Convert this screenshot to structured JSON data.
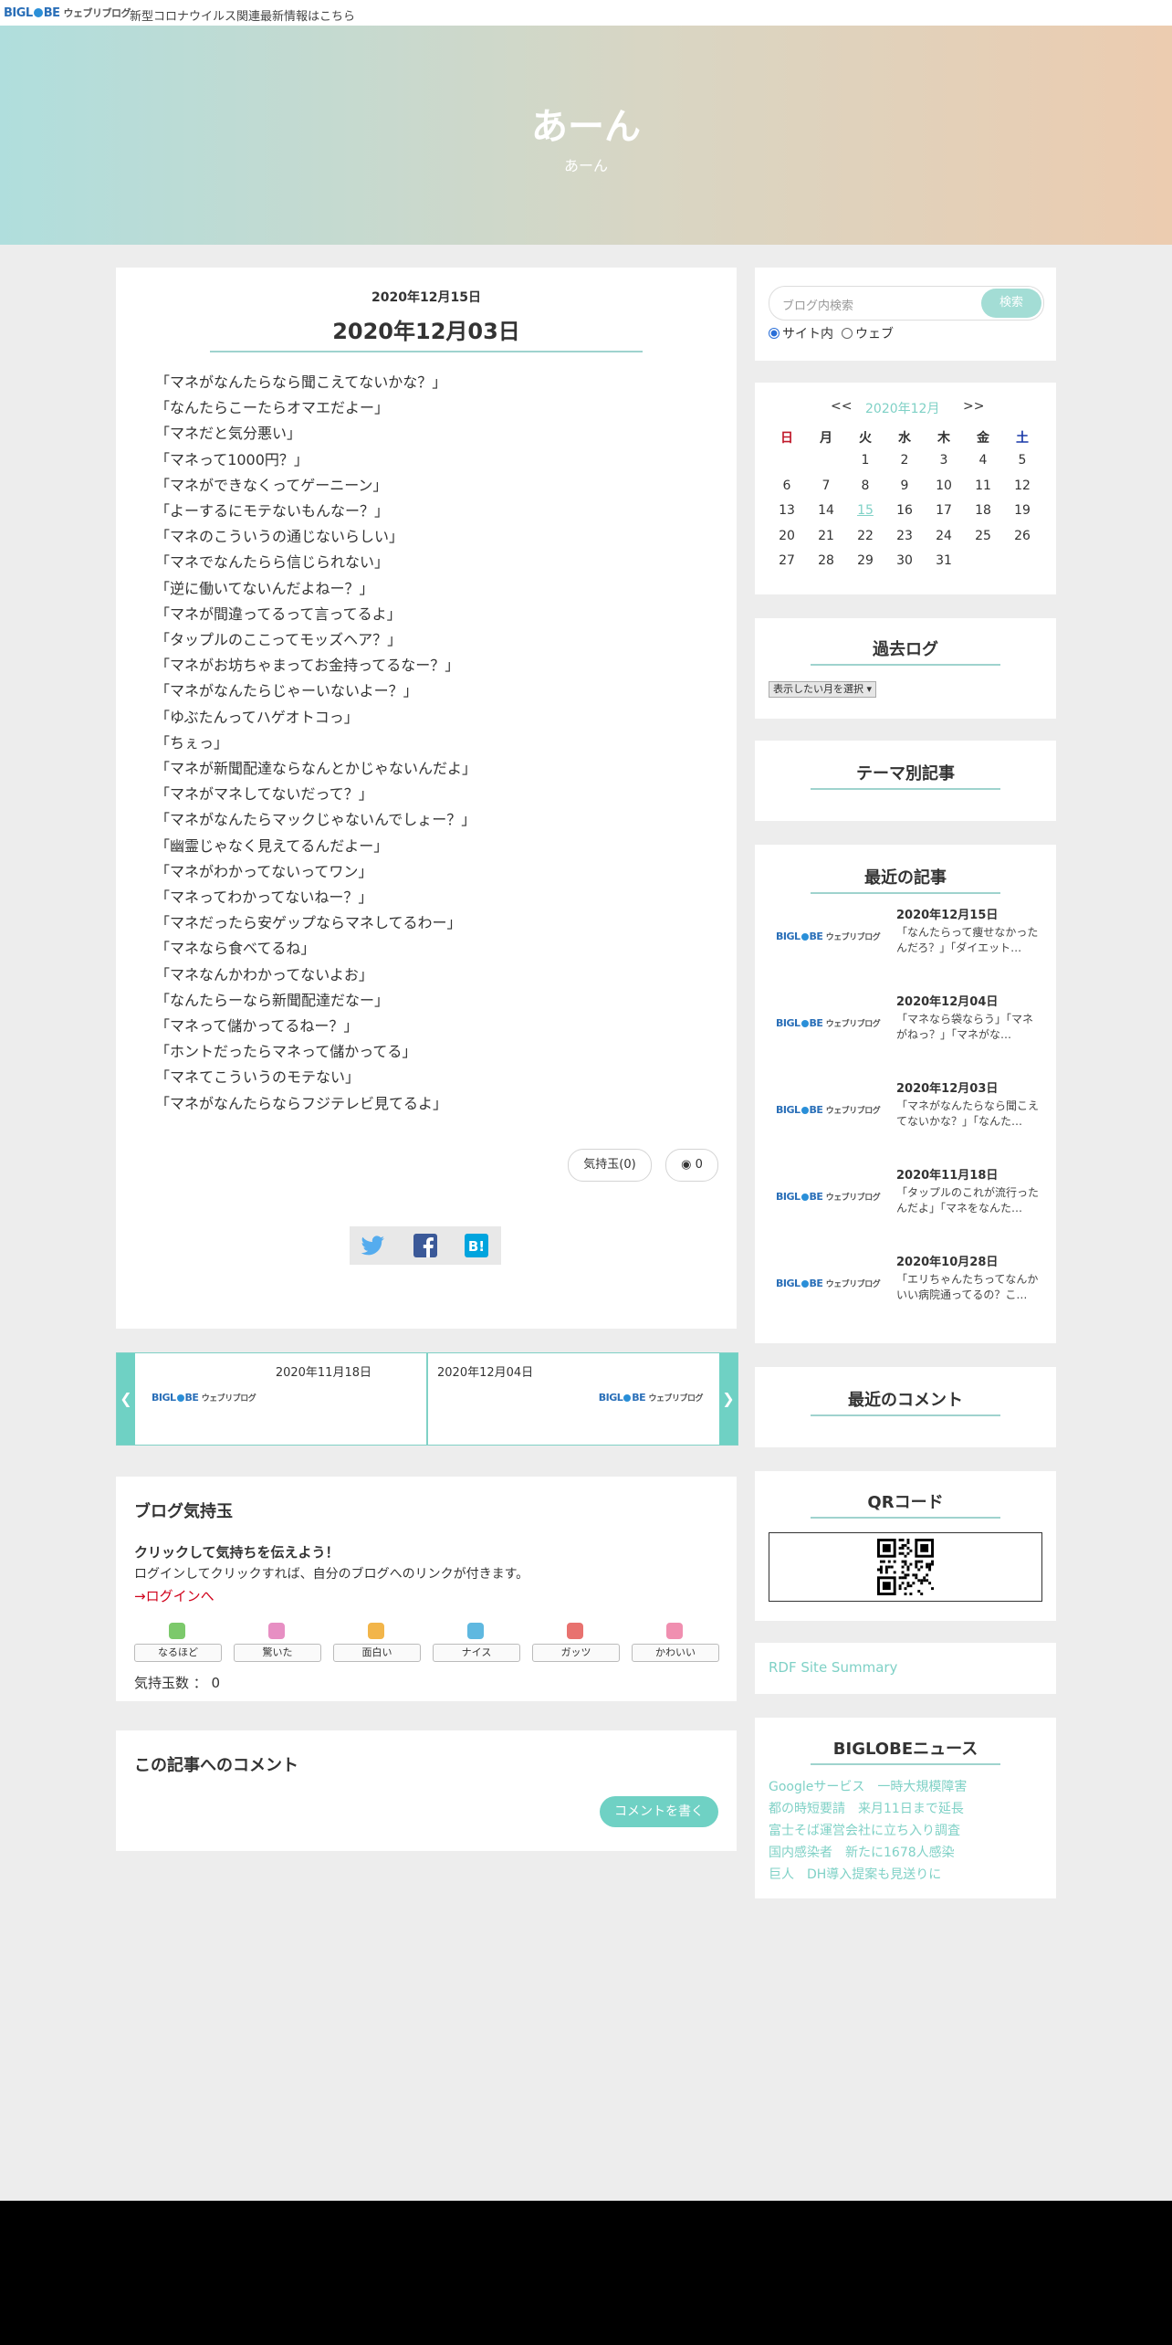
{
  "topbar": {
    "logo_main": "BIGL",
    "logo_main2": "BE",
    "logo_sub": "ウェブリブログ",
    "notice": "新型コロナウイルス関連最新情報はこちら"
  },
  "hero": {
    "title": "あーん",
    "tagline": "あーん"
  },
  "post": {
    "posted_date": "2020年12月15日",
    "title": "2020年12月03日",
    "lines": [
      "「マネがなんたらなら聞こえてないかな？」",
      "「なんたらこーたらオマエだよー」",
      "「マネだと気分悪い」",
      "「マネって1000円？」",
      "「マネができなくってゲーニーン」",
      "「よーするにモテないもんなー？」",
      "「マネのこういうの通じないらしい」",
      "「マネでなんたらら信じられない」",
      "「逆に働いてないんだよねー？」",
      "「マネが間違ってるって言ってるよ」",
      "「タップルのここってモッズヘア？」",
      "「マネがお坊ちゃまってお金持ってるなー？」",
      "「マネがなんたらじゃーいないよー？」",
      "「ゆぶたんってハゲオトコっ」",
      "「ちぇっ」",
      "「マネが新聞配達ならなんとかじゃないんだよ」",
      "「マネがマネしてないだって？」",
      "「マネがなんたらマックじゃないんでしょー？」",
      "「幽霊じゃなく見えてるんだよー」",
      "「マネがわかってないってワン」",
      "「マネってわかってないねー？」",
      "「マネだったら安ゲップならマネしてるわー」",
      "「マネなら食べてるね」",
      "「マネなんかわかってないよお」",
      "「なんたらーなら新聞配達だなー」",
      "「マネって儲かってるねー？」",
      "「ホントだったらマネって儲かってる」",
      "「マネてこういうのモテない」",
      "「マネがなんたらならフジテレビ見てるよ」"
    ],
    "kimochi_pill": "気持玉(0)",
    "comment_count": "0"
  },
  "post_nav": {
    "prev_date": "2020年11月18日",
    "next_date": "2020年12月04日",
    "logo_main": "BIGL",
    "logo_main2": "BE",
    "logo_sub": "ウェブリブログ"
  },
  "kimochi": {
    "heading": "ブログ気持玉",
    "cta": "クリックして気持ちを伝えよう！",
    "desc": "ログインしてクリックすれば、自分のブログへのリンクが付きます。",
    "login_link": "→ログインへ",
    "buttons": [
      "なるほど",
      "驚いた",
      "面白い",
      "ナイス",
      "ガッツ",
      "かわいい"
    ],
    "icon_colors": [
      "#7cc96b",
      "#e78fc3",
      "#f2b54a",
      "#5fb8e0",
      "#e8726f",
      "#f08fb0"
    ],
    "count_label": "気持玉数 ： 0"
  },
  "comments": {
    "heading": "この記事へのコメント",
    "write_button": "コメントを書く"
  },
  "sidebar": {
    "search": {
      "placeholder": "ブログ内検索",
      "button": "検索",
      "opt_site": "サイト内",
      "opt_web": "ウェブ"
    },
    "calendar": {
      "prev": "<<",
      "month": "2020年12月",
      "next": ">>",
      "weekdays": [
        "日",
        "月",
        "火",
        "水",
        "木",
        "金",
        "土"
      ],
      "weeks": [
        [
          "",
          "",
          "1",
          "2",
          "3",
          "4",
          "5"
        ],
        [
          "6",
          "7",
          "8",
          "9",
          "10",
          "11",
          "12"
        ],
        [
          "13",
          "14",
          "15",
          "16",
          "17",
          "18",
          "19"
        ],
        [
          "20",
          "21",
          "22",
          "23",
          "24",
          "25",
          "26"
        ],
        [
          "27",
          "28",
          "29",
          "30",
          "31",
          "",
          ""
        ]
      ],
      "linked_day": "15"
    },
    "archive": {
      "title": "過去ログ",
      "select": "表示したい月を選択"
    },
    "themes": {
      "title": "テーマ別記事"
    },
    "recent": {
      "title": "最近の記事",
      "logo_main": "BIGL",
      "logo_main2": "BE",
      "logo_sub": "ウェブリブログ",
      "items": [
        {
          "date": "2020年12月15日",
          "snippet": "「なんたらって痩せなかったんだろ？」「ダイエット…"
        },
        {
          "date": "2020年12月04日",
          "snippet": "「マネなら袋ならう」「マネがねっ？」「マネがな…"
        },
        {
          "date": "2020年12月03日",
          "snippet": "「マネがなんたらなら聞こえてないかな？」「なんた…"
        },
        {
          "date": "2020年11月18日",
          "snippet": "「タップルのこれが流行ったんだよ」「マネをなんた…"
        },
        {
          "date": "2020年10月28日",
          "snippet": "「エリちゃんたちってなんかいい病院通ってるの？こ…"
        }
      ]
    },
    "recent_comments": {
      "title": "最近のコメント"
    },
    "qr": {
      "title": "QRコード"
    },
    "rdf": {
      "label": "RDF Site Summary"
    },
    "news": {
      "title": "BIGLOBEニュース",
      "items": [
        "Googleサービス　一時大規模障害",
        "都の時短要請　来月11日まで延長",
        "富士そば運営会社に立ち入り調査",
        "国内感染者　新たに1678人感染",
        "巨人　DH導入提案も見送りに"
      ]
    }
  }
}
